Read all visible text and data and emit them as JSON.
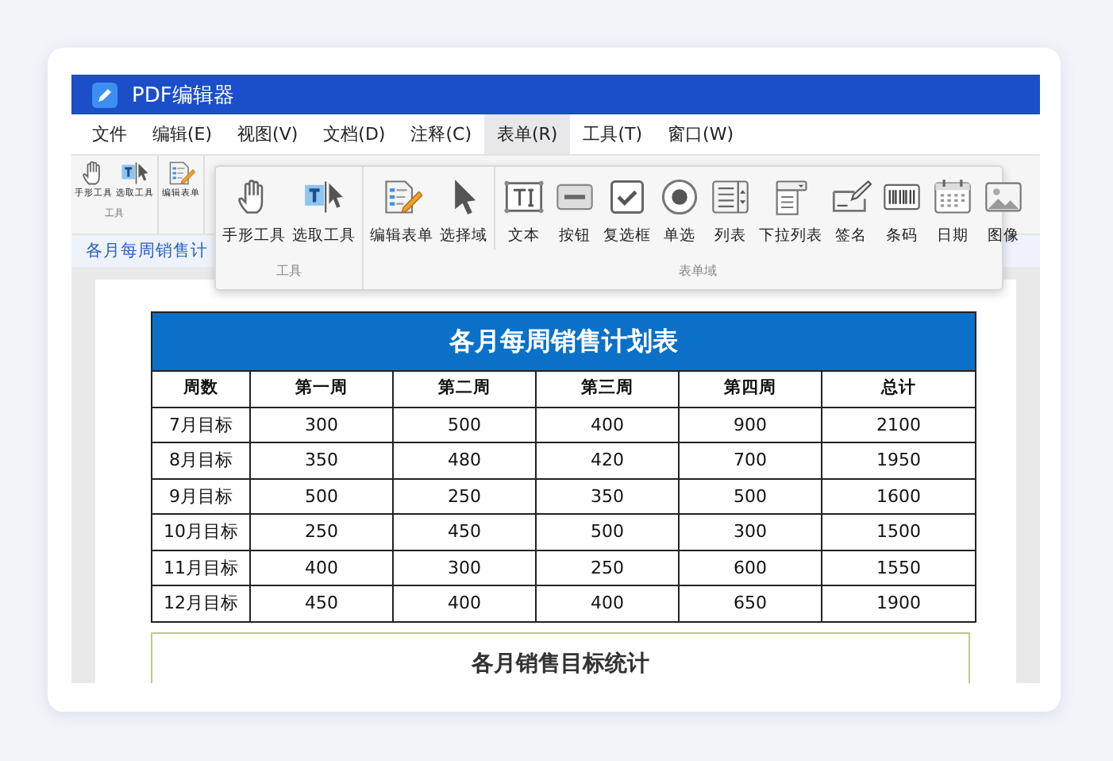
{
  "window": {
    "title": "PDF编辑器"
  },
  "menu": [
    {
      "label": "文件",
      "selected": false
    },
    {
      "label": "编辑(E)",
      "selected": false
    },
    {
      "label": "视图(V)",
      "selected": false
    },
    {
      "label": "文档(D)",
      "selected": false
    },
    {
      "label": "注释(C)",
      "selected": false
    },
    {
      "label": "表单(R)",
      "selected": true
    },
    {
      "label": "工具(T)",
      "selected": false
    },
    {
      "label": "窗口(W)",
      "selected": false
    }
  ],
  "ribbon": {
    "groups": [
      {
        "label": "工具",
        "items": [
          {
            "label": "手形工具",
            "kind": "hand"
          },
          {
            "label": "选取工具",
            "kind": "select"
          }
        ]
      },
      {
        "items": [
          {
            "label": "编辑表单",
            "kind": "editform"
          }
        ]
      }
    ]
  },
  "document_tab": "各月每周销售计",
  "popup": {
    "groups": [
      {
        "label": "工具",
        "sections": [
          [
            {
              "label": "手形工具",
              "kind": "hand"
            },
            {
              "label": "选取工具",
              "kind": "select"
            }
          ]
        ]
      },
      {
        "label": "表单域",
        "sections": [
          [
            {
              "label": "编辑表单",
              "kind": "editform"
            },
            {
              "label": "选择域",
              "kind": "arrow"
            }
          ],
          [
            {
              "label": "文本",
              "kind": "textfield"
            },
            {
              "label": "按钮",
              "kind": "button"
            },
            {
              "label": "复选框",
              "kind": "checkbox"
            },
            {
              "label": "单选",
              "kind": "radio"
            },
            {
              "label": "列表",
              "kind": "list"
            },
            {
              "label": "下拉列表",
              "kind": "dropdown"
            },
            {
              "label": "签名",
              "kind": "signature"
            },
            {
              "label": "条码",
              "kind": "barcode"
            },
            {
              "label": "日期",
              "kind": "date"
            },
            {
              "label": "图像",
              "kind": "image"
            }
          ]
        ]
      }
    ]
  },
  "table": {
    "title": "各月每周销售计划表",
    "columns": [
      "周数",
      "第一周",
      "第二周",
      "第三周",
      "第四周",
      "总计"
    ],
    "rows": [
      [
        "7月目标",
        "300",
        "500",
        "400",
        "900",
        "2100"
      ],
      [
        "8月目标",
        "350",
        "480",
        "420",
        "700",
        "1950"
      ],
      [
        "9月目标",
        "500",
        "250",
        "350",
        "500",
        "1600"
      ],
      [
        "10月目标",
        "250",
        "450",
        "500",
        "300",
        "1500"
      ],
      [
        "11月目标",
        "400",
        "300",
        "250",
        "600",
        "1550"
      ],
      [
        "12月目标",
        "450",
        "400",
        "400",
        "650",
        "1900"
      ]
    ]
  },
  "second_table": {
    "title": "各月销售目标统计"
  }
}
